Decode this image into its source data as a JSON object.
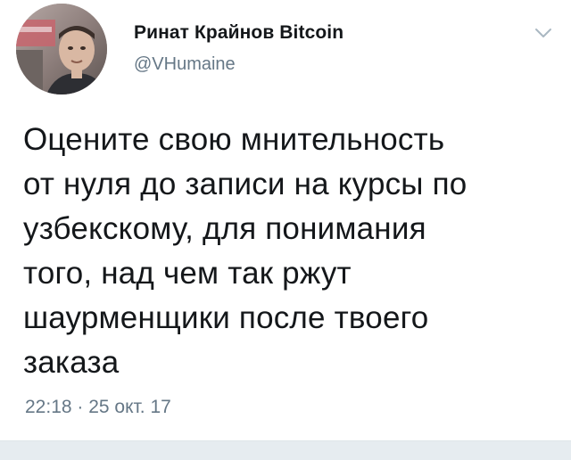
{
  "tweet": {
    "author": {
      "display_name": "Ринат Крайнов Bitcoin",
      "handle": "@VHumaine"
    },
    "text": "Оцените свою мнительность\nот нуля до записи на курсы по\nузбекскому, для понимания\nтого, над чем так ржут\nшаурменщики после твоего\nзаказа",
    "timestamp": "22:18 · 25 окт. 17"
  },
  "icons": {
    "menu": "chevron-down-icon"
  },
  "colors": {
    "text": "#14171a",
    "secondary": "#657786",
    "caret": "#aab8c2",
    "divider": "#e6ecf0"
  }
}
